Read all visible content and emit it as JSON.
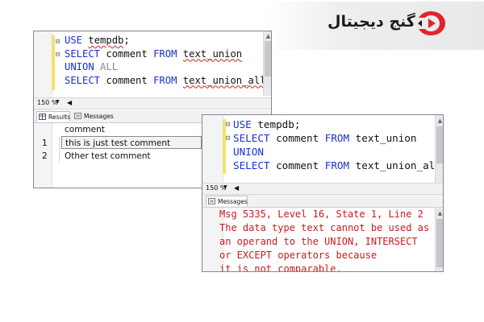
{
  "brand": {
    "name": "گنج دیجیتال",
    "accent": "#e2232f"
  },
  "window1": {
    "code_lines": [
      [
        {
          "t": "USE ",
          "c": "kw"
        },
        {
          "t": "tempdb",
          "c": "ident"
        },
        {
          "t": ";",
          "c": "plain"
        }
      ],
      [
        {
          "t": "SELECT ",
          "c": "kw"
        },
        {
          "t": "comment ",
          "c": "plain"
        },
        {
          "t": "FROM ",
          "c": "kw"
        },
        {
          "t": "text_union",
          "c": "ident"
        }
      ],
      [
        {
          "t": "UNION ",
          "c": "kw"
        },
        {
          "t": "ALL",
          "c": "gray"
        }
      ],
      [
        {
          "t": "SELECT ",
          "c": "kw"
        },
        {
          "t": "comment ",
          "c": "plain"
        },
        {
          "t": "FROM ",
          "c": "kw"
        },
        {
          "t": "text_union_all",
          "c": "ident"
        }
      ]
    ],
    "zoom": "150 %",
    "tabs": {
      "results": "Results",
      "messages": "Messages"
    },
    "grid": {
      "column": "comment",
      "rows": [
        {
          "num": "1",
          "value": "this is just test comment"
        },
        {
          "num": "2",
          "value": "Other test comment"
        }
      ]
    }
  },
  "window2": {
    "code_lines": [
      [
        {
          "t": "USE ",
          "c": "kw"
        },
        {
          "t": "tempdb",
          "c": "plain"
        },
        {
          "t": ";",
          "c": "plain"
        }
      ],
      [
        {
          "t": "SELECT ",
          "c": "kw"
        },
        {
          "t": "comment ",
          "c": "plain"
        },
        {
          "t": "FROM ",
          "c": "kw"
        },
        {
          "t": "text_union",
          "c": "plain"
        }
      ],
      [
        {
          "t": "UNION",
          "c": "kw"
        }
      ],
      [
        {
          "t": "SELECT ",
          "c": "kw"
        },
        {
          "t": "comment ",
          "c": "plain"
        },
        {
          "t": "FROM ",
          "c": "kw"
        },
        {
          "t": "text_union_all",
          "c": "plain"
        }
      ]
    ],
    "zoom": "150 %",
    "tabs": {
      "messages": "Messages"
    },
    "messages": [
      "Msg 5335, Level 16, State 1, Line 2",
      "The data type text cannot be used as",
      "an operand to the UNION, INTERSECT",
      "or EXCEPT operators because",
      "it is not comparable."
    ],
    "message_color": "#c81c1c"
  }
}
